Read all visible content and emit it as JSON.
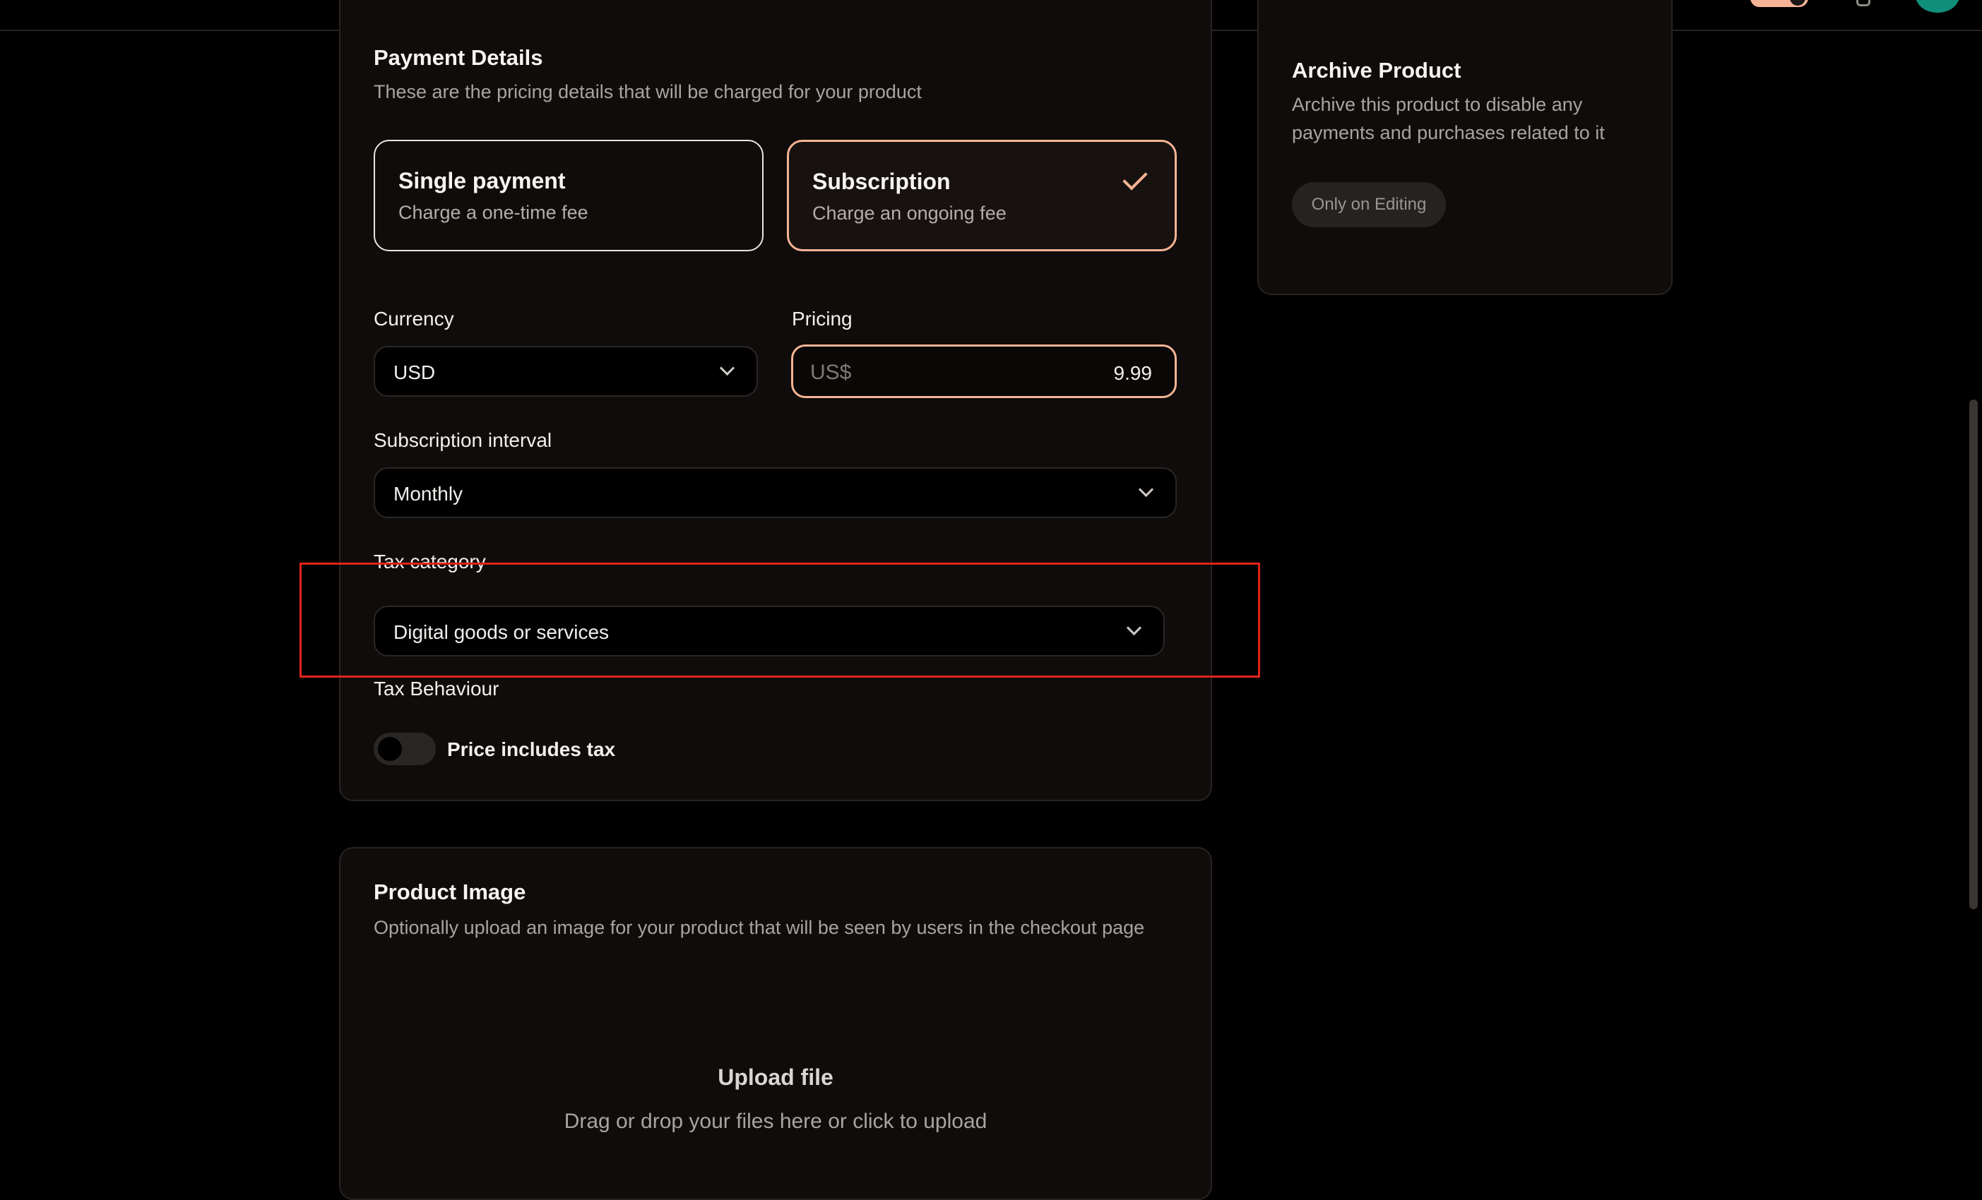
{
  "payment": {
    "title": "Payment Details",
    "subtitle": "These are the pricing details that will be charged for your product",
    "options": [
      {
        "title": "Single payment",
        "description": "Charge a one-time fee",
        "selected": false
      },
      {
        "title": "Subscription",
        "description": "Charge an ongoing fee",
        "selected": true
      }
    ],
    "currency_label": "Currency",
    "currency_value": "USD",
    "pricing_label": "Pricing",
    "pricing_prefix": "US$",
    "pricing_value": "9.99",
    "interval_label": "Subscription interval",
    "interval_value": "Monthly",
    "tax_category_label": "Tax category",
    "tax_category_value": "Digital goods or services",
    "tax_behaviour_label": "Tax Behaviour",
    "price_includes_tax_label": "Price includes tax",
    "price_includes_tax": false
  },
  "archive": {
    "title": "Archive Product",
    "description": "Archive this product to disable any payments and purchases related to it",
    "button_label": "Only on Editing"
  },
  "image": {
    "title": "Product Image",
    "subtitle": "Optionally upload an image for your product that will be seen by users in the checkout page",
    "upload_title": "Upload file",
    "upload_subtitle": "Drag or drop your files here or click to upload"
  },
  "colors": {
    "accent": "#f4b495",
    "background": "#000000",
    "card": "#0f0c0b",
    "highlight_box": "#e2231a",
    "avatar": "#0f8f7a"
  },
  "icons": [
    "check-icon",
    "chevron-down-icon",
    "bell-icon"
  ]
}
